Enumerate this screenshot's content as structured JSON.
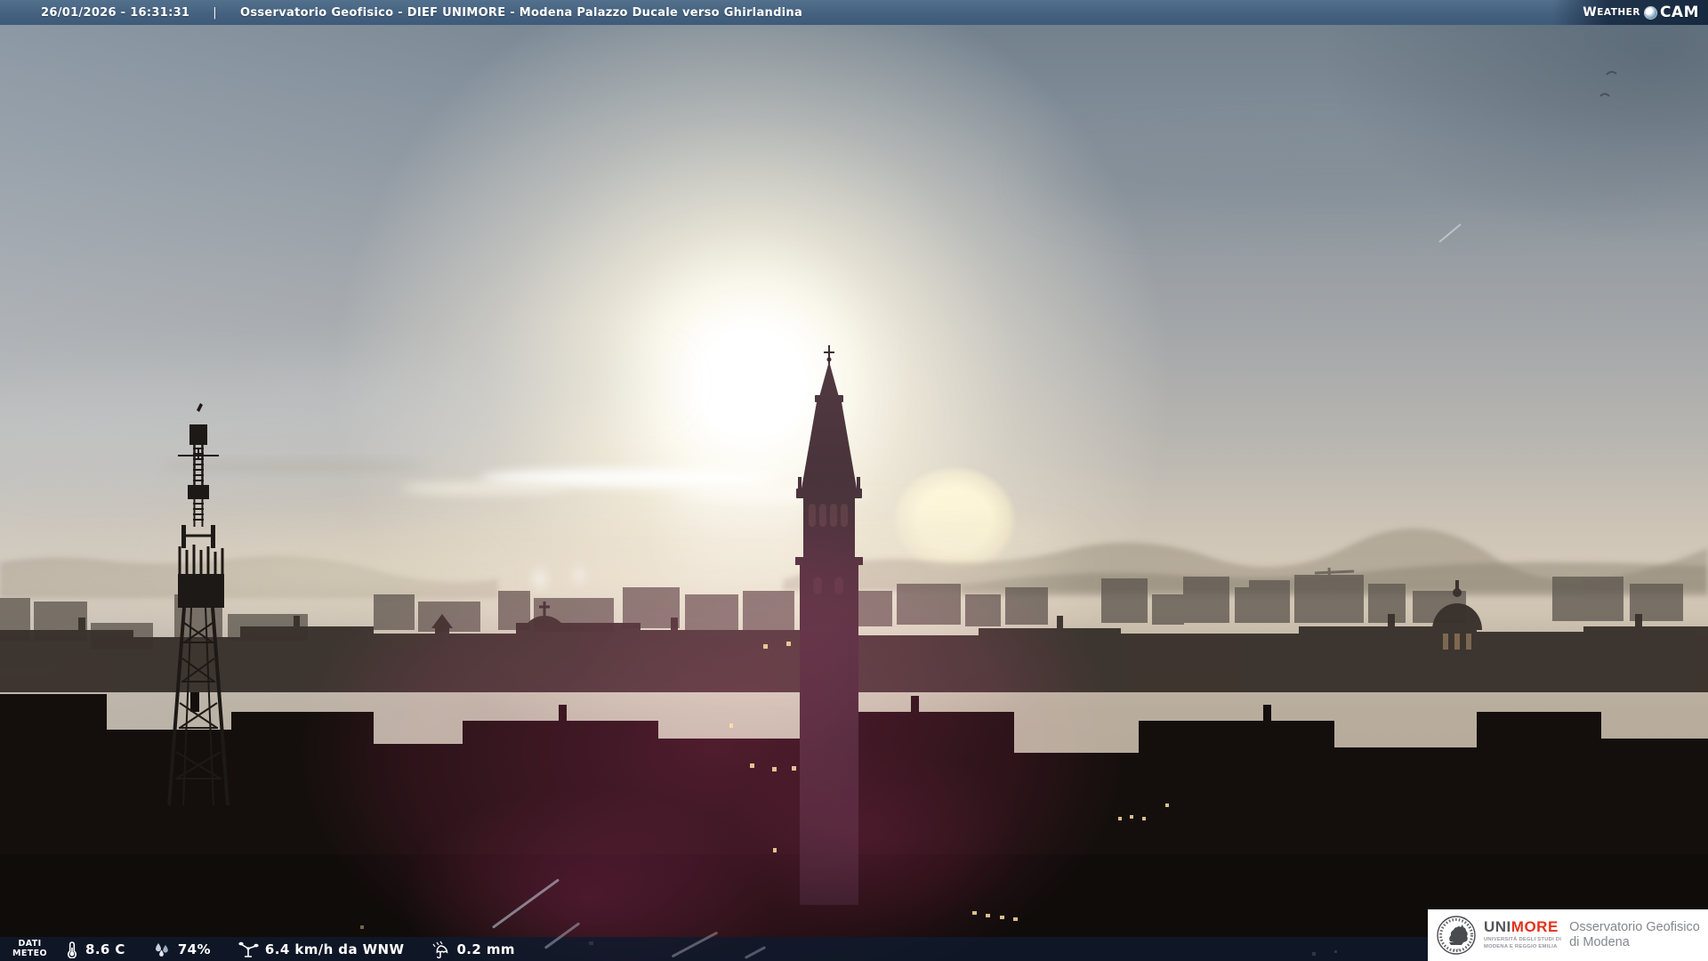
{
  "top_bar": {
    "datetime": "26/01/2026 - 16:31:31",
    "separator": "|",
    "title": "Osservatorio Geofisico - DIEF UNIMORE - Modena Palazzo Ducale verso Ghirlandina",
    "brand": {
      "w": "W",
      "eather": "EATHER",
      "cam": "CAM"
    }
  },
  "bottom_bar": {
    "label": {
      "line1": "DATI",
      "line2": "METEO"
    },
    "temperature": {
      "icon": "thermometer-icon",
      "value": "8.6 C"
    },
    "humidity": {
      "icon": "humidity-drops-icon",
      "value": "74%"
    },
    "wind": {
      "icon": "anemometer-icon",
      "value": "6.4 km/h da WNW"
    },
    "rain": {
      "icon": "rain-umbrella-icon",
      "value": "0.2 mm"
    }
  },
  "logo_box": {
    "seal_icon": "unimore-seal-icon",
    "brand": {
      "uni": "UNI",
      "more": "MORE"
    },
    "subtitle": {
      "line1": "UNIVERSITÀ DEGLI STUDI DI",
      "line2": "MODENA E REGGIO EMILIA"
    },
    "observatory": {
      "line1": "Osservatorio Geofisico",
      "line2": "di Modena"
    }
  },
  "colors": {
    "top_bar_bg": "#44617F",
    "bottom_bar_bg": "#0F1A2D",
    "brand_red": "#E2321B",
    "brand_gray": "#55565A",
    "text_white": "#FFFFFF"
  }
}
